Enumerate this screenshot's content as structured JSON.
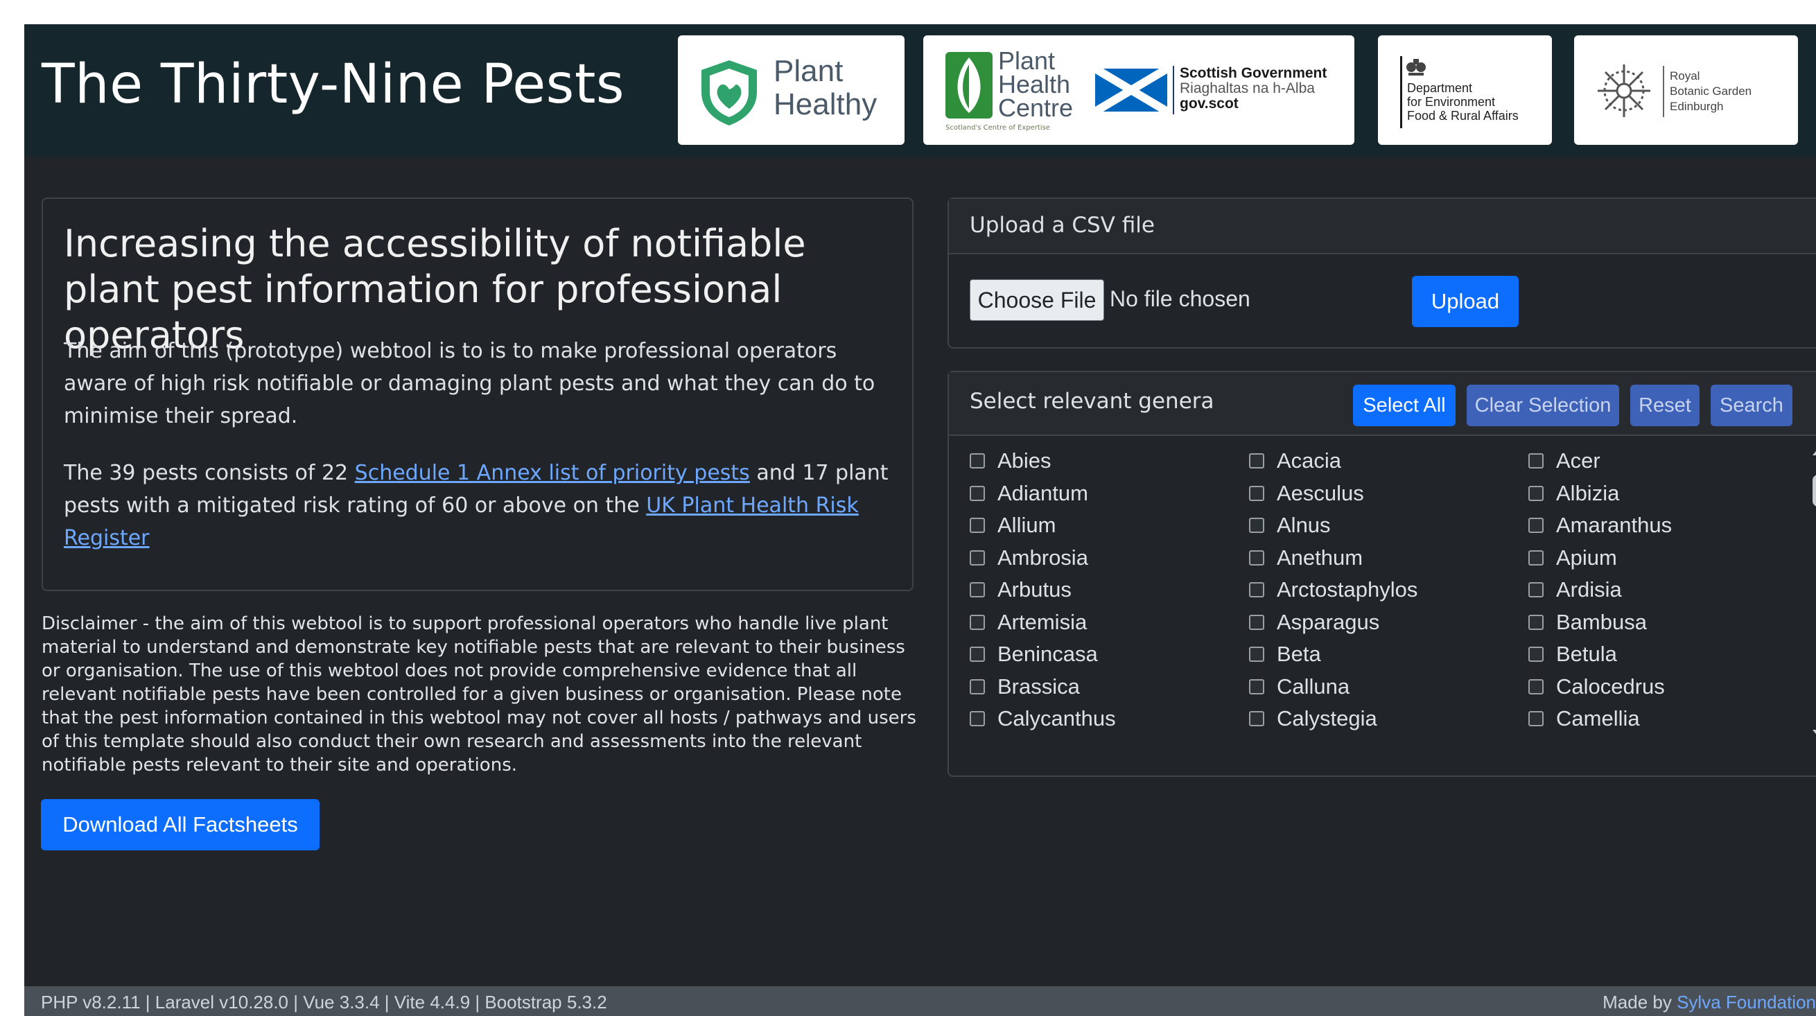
{
  "header": {
    "title": "The Thirty-Nine Pests",
    "logos": {
      "plant_healthy": {
        "line1": "Plant",
        "line2": "Healthy"
      },
      "phc": {
        "line1": "Plant",
        "line2": "Health",
        "line3": "Centre",
        "sub": "Scotland's Centre of Expertise"
      },
      "scot_gov": {
        "line1": "Scottish Government",
        "line2": "Riaghaltas na h-Alba",
        "line3": "gov.scot"
      },
      "defra": {
        "line1": "Department",
        "line2": "for Environment",
        "line3": "Food & Rural Affairs"
      },
      "rbge": {
        "line1": "Royal",
        "line2": "Botanic Garden",
        "line3": "Edinburgh"
      }
    }
  },
  "intro": {
    "heading": "Increasing the accessibility of notifiable plant pest information for professional operators",
    "paragraph1": "The aim of this (prototype) webtool is to is to make professional operators aware of high risk notifiable or damaging plant pests and what they can do to minimise their spread.",
    "paragraph2_before": "The 39 pests consists of 22 ",
    "paragraph2_link1": "Schedule 1 Annex list of priority pests",
    "paragraph2_middle": " and 17 plant pests with a mitigated risk rating of 60 or above on the ",
    "paragraph2_link2": "UK Plant Health Risk Register"
  },
  "disclaimer": "Disclaimer - the aim of this webtool is to support professional operators who handle live plant material to understand and demonstrate key notifiable pests that are relevant to their business or organisation. The use of this webtool does not provide comprehensive evidence that all relevant notifiable pests have been controlled for a given business or organisation. Please note that the pest information contained in this webtool may not cover all hosts / pathways and users of this template should also conduct their own research and assessments into the relevant notifiable pests relevant to their site and operations.",
  "download_button": "Download All Factsheets",
  "upload": {
    "title": "Upload a CSV file",
    "choose_file": "Choose File",
    "file_status": "No file chosen",
    "upload_button": "Upload"
  },
  "genera": {
    "title": "Select relevant genera",
    "buttons": {
      "select_all": "Select All",
      "clear": "Clear Selection",
      "reset": "Reset",
      "search": "Search"
    },
    "items": [
      "Abies",
      "Acacia",
      "Acer",
      "Adiantum",
      "Aesculus",
      "Albizia",
      "Allium",
      "Alnus",
      "Amaranthus",
      "Ambrosia",
      "Anethum",
      "Apium",
      "Arbutus",
      "Arctostaphylos",
      "Ardisia",
      "Artemisia",
      "Asparagus",
      "Bambusa",
      "Benincasa",
      "Beta",
      "Betula",
      "Brassica",
      "Calluna",
      "Calocedrus",
      "Calycanthus",
      "Calystegia",
      "Camellia"
    ]
  },
  "footer": {
    "versions": "PHP v8.2.11 | Laravel v10.28.0 | Vue 3.3.4 | Vite 4.4.9 | Bootstrap 5.3.2",
    "made_by_prefix": "Made by ",
    "made_by_link": "Sylva Foundation"
  },
  "colors": {
    "primary": "#0d6efd",
    "header_bg": "#16262d",
    "page_bg": "#212529",
    "link": "#6ea8fe"
  }
}
